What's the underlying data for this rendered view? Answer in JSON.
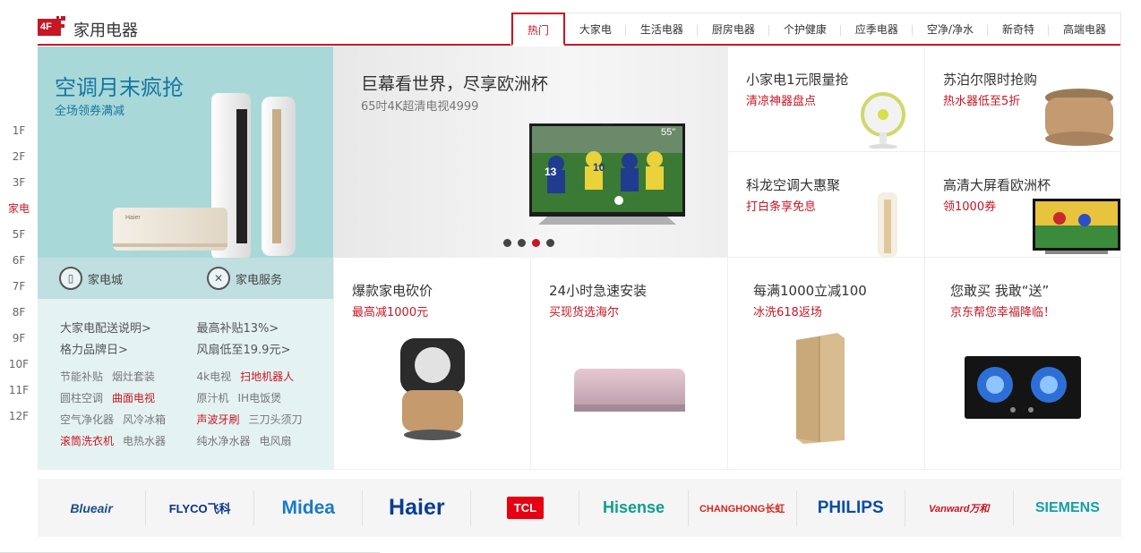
{
  "floor_nav": [
    "1F",
    "2F",
    "3F",
    "家电",
    "5F",
    "6F",
    "7F",
    "8F",
    "9F",
    "10F",
    "11F",
    "12F"
  ],
  "floor_nav_active": 3,
  "header": {
    "badge": "4F",
    "title": "家用电器",
    "tabs": [
      "热门",
      "大家电",
      "生活电器",
      "厨房电器",
      "个护健康",
      "应季电器",
      "空净/净水",
      "新奇特",
      "高端电器"
    ],
    "active_tab": 0,
    "accent": "#c81623"
  },
  "left_banner": {
    "title": "空调月末疯抢",
    "subtitle": "全场领券满减"
  },
  "left_services": [
    {
      "label": "家电城",
      "icon": "appliance-store-icon"
    },
    {
      "label": "家电服务",
      "icon": "tools-icon"
    }
  ],
  "left_links": [
    [
      "大家电配送说明>",
      "最高补贴13%>"
    ],
    [
      "格力品牌日>",
      "风扇低至19.9元>"
    ]
  ],
  "left_tags": [
    [
      [
        {
          "t": "节能补贴",
          "red": false
        },
        {
          "t": "烟灶套装",
          "red": false
        }
      ],
      [
        {
          "t": "4k电视",
          "red": false
        },
        {
          "t": "扫地机器人",
          "red": true
        }
      ]
    ],
    [
      [
        {
          "t": "圆柱空调",
          "red": false
        },
        {
          "t": "曲面电视",
          "red": true
        }
      ],
      [
        {
          "t": "原汁机",
          "red": false
        },
        {
          "t": "IH电饭煲",
          "red": false
        }
      ]
    ],
    [
      [
        {
          "t": "空气净化器",
          "red": false
        },
        {
          "t": "风冷冰箱",
          "red": false
        }
      ],
      [
        {
          "t": "声波牙刷",
          "red": true
        },
        {
          "t": "三刀头须刀",
          "red": false
        }
      ]
    ],
    [
      [
        {
          "t": "滚筒洗衣机",
          "red": true
        },
        {
          "t": "电热水器",
          "red": false
        }
      ],
      [
        {
          "t": "纯水净水器",
          "red": false
        },
        {
          "t": "电风扇",
          "red": false
        }
      ]
    ]
  ],
  "center_banner": {
    "title": "巨幕看世界，尽享欧洲杯",
    "subtitle": "65吋4K超清电视4999",
    "tv_size": "55\"",
    "jersey_numbers": [
      "13",
      "10"
    ],
    "slides": 4,
    "active_slide": 2
  },
  "right_cells": [
    {
      "title": "小家电1元限量抢",
      "sub": "清凉神器盘点"
    },
    {
      "title": "苏泊尔限时抢购",
      "sub": "热水器低至5折"
    },
    {
      "title": "科龙空调大惠聚",
      "sub": "打白条享免息"
    },
    {
      "title": "高清大屏看欧洲杯",
      "sub": "领1000券"
    }
  ],
  "bottom_cells": [
    {
      "title": "爆款家电砍价",
      "sub": "最高减1000元"
    },
    {
      "title": "24小时急速安装",
      "sub": "买现货选海尔"
    },
    {
      "title": "每满1000立减100",
      "sub": "冰洗618返场"
    },
    {
      "title": "您敢买  我敢“送”",
      "sub": "京东帮您幸福降临！"
    }
  ],
  "brands": [
    "Blueair",
    "FLYCO飞科",
    "Midea",
    "Haier",
    "TCL",
    "Hisense",
    "CHANGHONG长虹",
    "PHILIPS",
    "Vanward万和",
    "SIEMENS"
  ],
  "brand_colors": [
    "#1a4f8a",
    "#0c2f8f",
    "#1b79c9",
    "#0a3d91",
    "#e60012",
    "#0f9e8f",
    "#d7261e",
    "#0b4ea2",
    "#c81623",
    "#17a0a3"
  ]
}
